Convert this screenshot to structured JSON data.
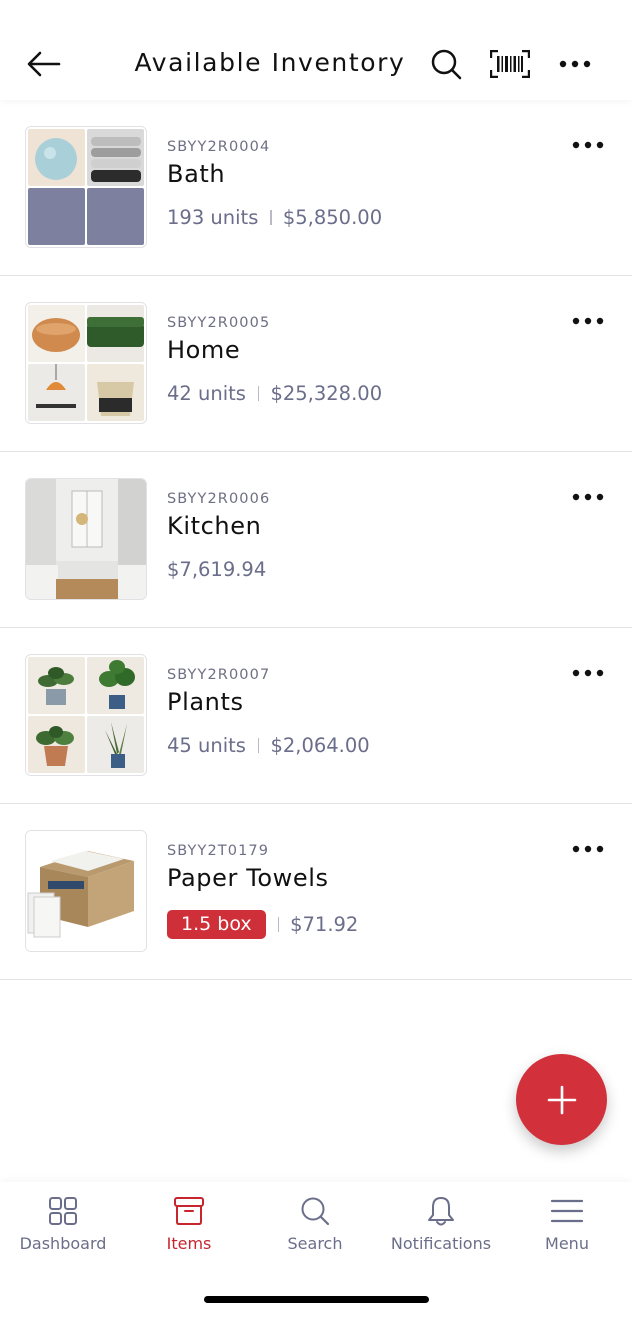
{
  "header": {
    "title": "Available Inventory"
  },
  "items": [
    {
      "sku": "SBYY2R0004",
      "name": "Bath",
      "units": "193 units",
      "price": "$5,850.00"
    },
    {
      "sku": "SBYY2R0005",
      "name": "Home",
      "units": "42 units",
      "price": "$25,328.00"
    },
    {
      "sku": "SBYY2R0006",
      "name": "Kitchen",
      "price": "$7,619.94"
    },
    {
      "sku": "SBYY2R0007",
      "name": "Plants",
      "units": "45 units",
      "price": "$2,064.00"
    },
    {
      "sku": "SBYY2T0179",
      "name": "Paper Towels",
      "quantity_badge": "1.5 box",
      "price": "$71.92"
    }
  ],
  "tabs": [
    {
      "label": "Dashboard",
      "icon": "dashboard-grid-icon"
    },
    {
      "label": "Items",
      "icon": "box-icon",
      "active": true
    },
    {
      "label": "Search",
      "icon": "search-icon"
    },
    {
      "label": "Notifications",
      "icon": "bell-icon"
    },
    {
      "label": "Menu",
      "icon": "hamburger-menu-icon"
    }
  ],
  "colors": {
    "accent": "#d2313b",
    "muted_text": "#6b6e8a",
    "divider": "#e3e3e6"
  }
}
